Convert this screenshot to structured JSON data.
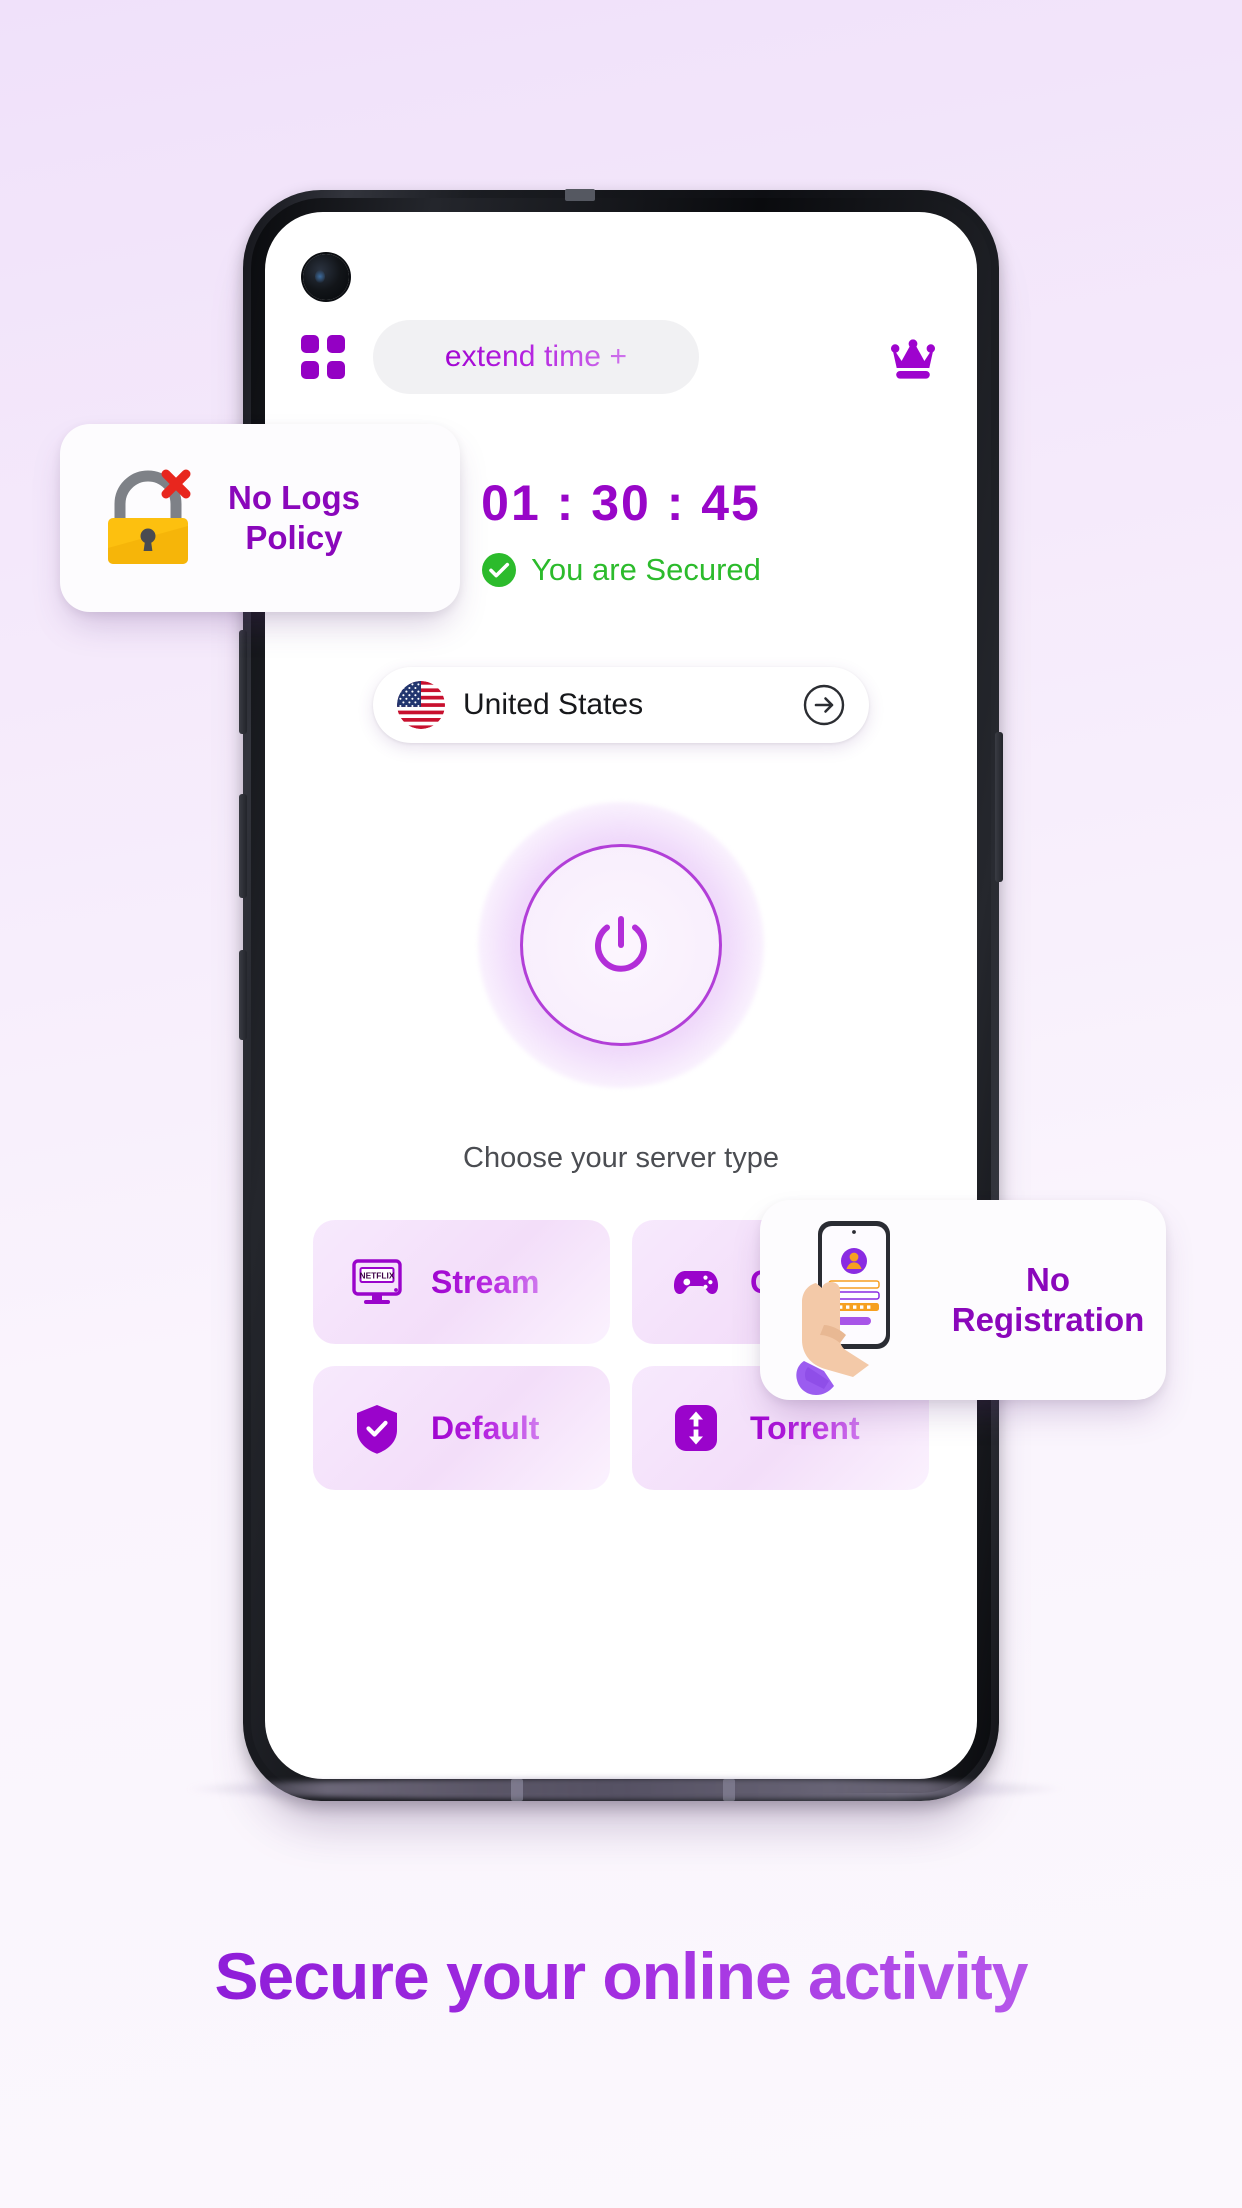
{
  "background": {
    "gradient_from": "#f0e1fa",
    "gradient_to": "#fbf8fd"
  },
  "theme": {
    "brand_purple": "#9400c4",
    "brand_purple_dark": "#8a07bb",
    "accent_green": "#2cbb2c",
    "tile_bg": "#f7e9fd",
    "screen_bg": "#ffffff"
  },
  "phone": {
    "frame_color": "#14151a",
    "buttons": [
      "volume-up",
      "volume-down",
      "extra-left",
      "power"
    ]
  },
  "app": {
    "topbar": {
      "menu_icon": "grid-menu-icon",
      "extend_time_label": "extend time +",
      "premium_icon": "crown-icon"
    },
    "timer": {
      "value": "01 : 30 : 45",
      "hours": "01",
      "minutes": "30",
      "seconds": "45"
    },
    "status": {
      "icon": "check-circle-icon",
      "label": "You are Secured",
      "color": "#2cbb2c"
    },
    "country_selector": {
      "flag_icon": "us-flag-icon",
      "name": "United States",
      "arrow_icon": "arrow-right-circle-icon"
    },
    "power_button": {
      "icon": "power-icon",
      "state": "off"
    },
    "server_section": {
      "heading": "Choose your server type",
      "tiles": [
        {
          "label": "Stream",
          "icon": "netflix-monitor-icon"
        },
        {
          "label": "Gaming",
          "icon": "gamepad-icon"
        },
        {
          "label": "Default",
          "icon": "shield-check-icon"
        },
        {
          "label": "Torrent",
          "icon": "up-down-arrows-icon"
        }
      ]
    }
  },
  "badges": [
    {
      "id": "no-logs-policy",
      "icon": "padlock-with-x-icon",
      "line1": "No Logs",
      "line2": "Policy"
    },
    {
      "id": "no-registration",
      "icon": "hand-holding-phone-icon",
      "line1": "No",
      "line2": "Registration"
    }
  ],
  "tagline": "Secure your online activity"
}
